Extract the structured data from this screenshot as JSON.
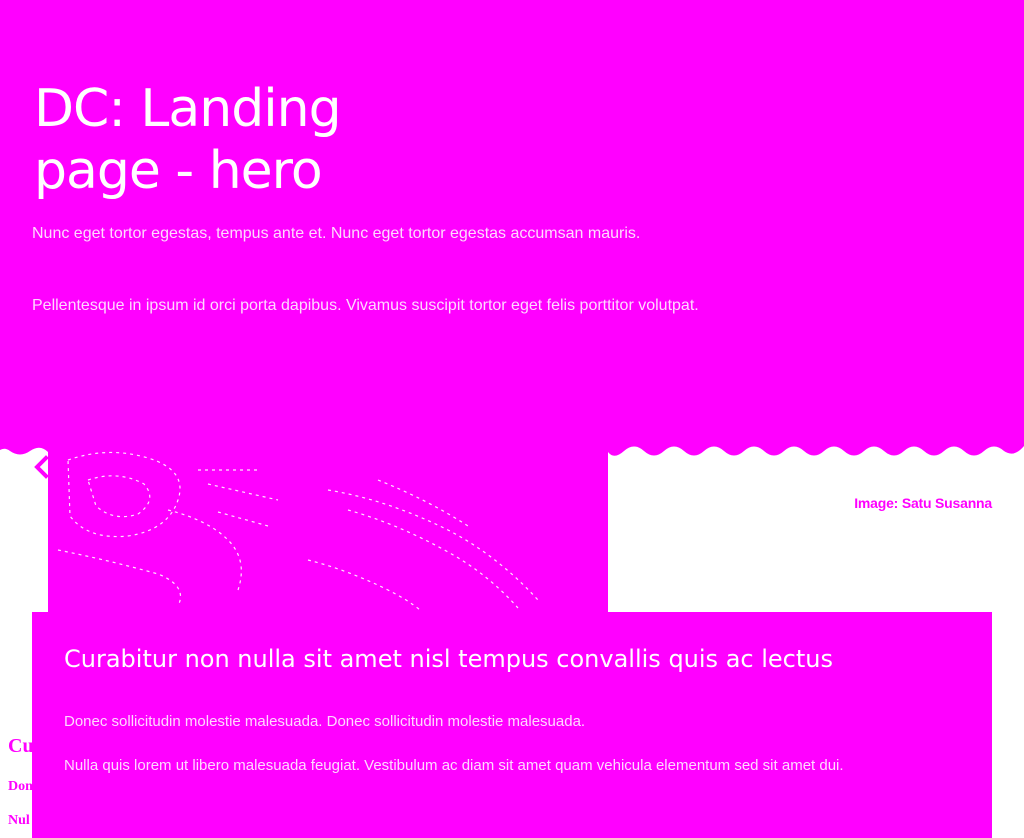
{
  "hero": {
    "title": "DC: Landing page - hero",
    "lead": "Nunc eget tortor egestas, tempus ante et. Nunc eget tortor egestas accumsan mauris.",
    "lead_2": "Pellentesque in ipsum id orci porta dapibus. Vivamus suscipit tortor eget felis porttitor volutpat.",
    "background_color": "#ff00ff",
    "text_color": "#ffffff"
  },
  "image": {
    "credit": "Image: Satu Susanna",
    "back_icon": "chevron-left-icon"
  },
  "card": {
    "title": "Curabitur non nulla sit amet nisl tempus convallis quis ac lectus",
    "text_1": "Donec sollicitudin molestie malesuada. Donec sollicitudin molestie malesuada.",
    "text_2": "Nulla quis lorem ut libero malesuada feugiat. Vestibulum ac diam sit amet quam vehicula elementum sed sit amet dui.",
    "background_color": "#ff00ff"
  },
  "side": {
    "heading": "Cu",
    "line_1": "Don",
    "line_2": "Nul"
  }
}
